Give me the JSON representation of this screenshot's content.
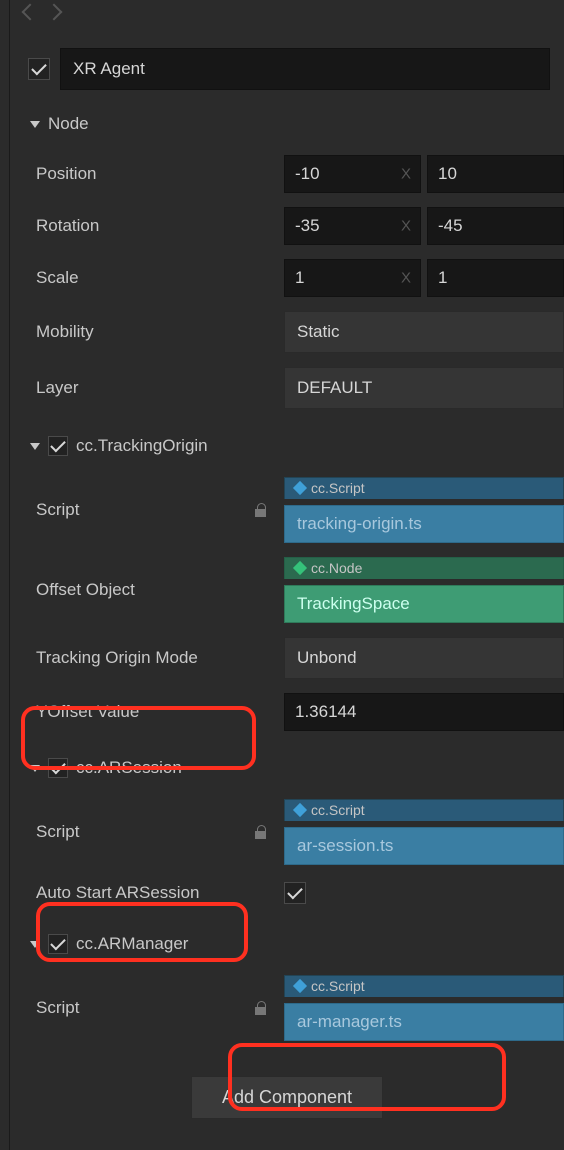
{
  "name": "XR Agent",
  "sections": {
    "node": {
      "title": "Node",
      "position": {
        "label": "Position",
        "x": "-10",
        "y": "10"
      },
      "rotation": {
        "label": "Rotation",
        "x": "-35",
        "y": "-45"
      },
      "scale": {
        "label": "Scale",
        "x": "1",
        "y": "1"
      },
      "mobility": {
        "label": "Mobility",
        "value": "Static"
      },
      "layer": {
        "label": "Layer",
        "value": "DEFAULT"
      }
    },
    "trackingOrigin": {
      "title": "cc.TrackingOrigin",
      "script": {
        "label": "Script",
        "tag": "cc.Script",
        "value": "tracking-origin.ts"
      },
      "offsetObject": {
        "label": "Offset Object",
        "tag": "cc.Node",
        "value": "TrackingSpace"
      },
      "mode": {
        "label": "Tracking Origin Mode",
        "value": "Unbond"
      },
      "yoffset": {
        "label": "YOffset Value",
        "value": "1.36144"
      }
    },
    "arSession": {
      "title": "cc.ARSession",
      "script": {
        "label": "Script",
        "tag": "cc.Script",
        "value": "ar-session.ts"
      },
      "autoStart": {
        "label": "Auto Start ARSession",
        "checked": true
      }
    },
    "arManager": {
      "title": "cc.ARManager",
      "script": {
        "label": "Script",
        "tag": "cc.Script",
        "value": "ar-manager.ts"
      }
    }
  },
  "addComponent": "Add Component",
  "axisLabel": "X"
}
